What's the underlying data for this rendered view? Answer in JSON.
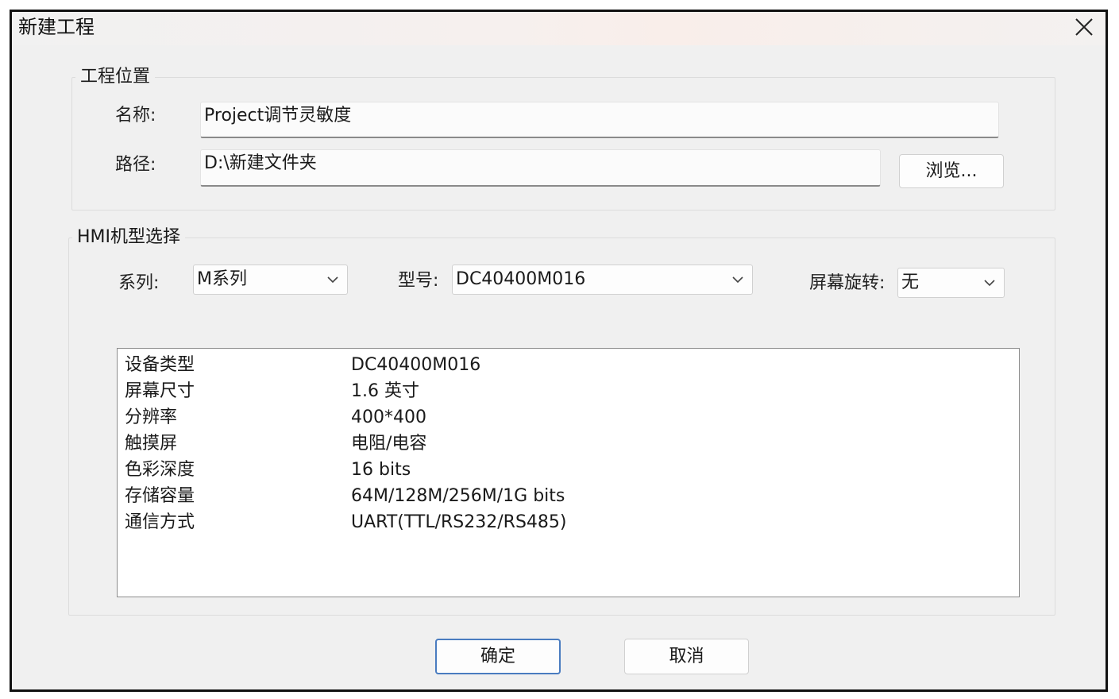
{
  "window": {
    "title": "新建工程",
    "close_icon": "close-icon"
  },
  "project_location": {
    "legend": "工程位置",
    "name_label": "名称:",
    "name_value": "Project调节灵敏度",
    "path_label": "路径:",
    "path_value": "D:\\新建文件夹",
    "browse_label": "浏览..."
  },
  "hmi_selection": {
    "legend": "HMI机型选择",
    "series_label": "系列:",
    "series_value": "M系列",
    "model_label": "型号:",
    "model_value": "DC40400M016",
    "rotation_label": "屏幕旋转:",
    "rotation_value": "无",
    "chevron_icon": "chevron-down-icon"
  },
  "device_info": [
    {
      "key": "设备类型",
      "value": "DC40400M016"
    },
    {
      "key": "屏幕尺寸",
      "value": "1.6 英寸"
    },
    {
      "key": "分辨率",
      "value": "400*400"
    },
    {
      "key": "触摸屏",
      "value": "电阻/电容"
    },
    {
      "key": "色彩深度",
      "value": "16 bits"
    },
    {
      "key": "存储容量",
      "value": "64M/128M/256M/1G bits"
    },
    {
      "key": "通信方式",
      "value": "UART(TTL/RS232/RS485)"
    }
  ],
  "buttons": {
    "ok_label": "确定",
    "cancel_label": "取消"
  }
}
